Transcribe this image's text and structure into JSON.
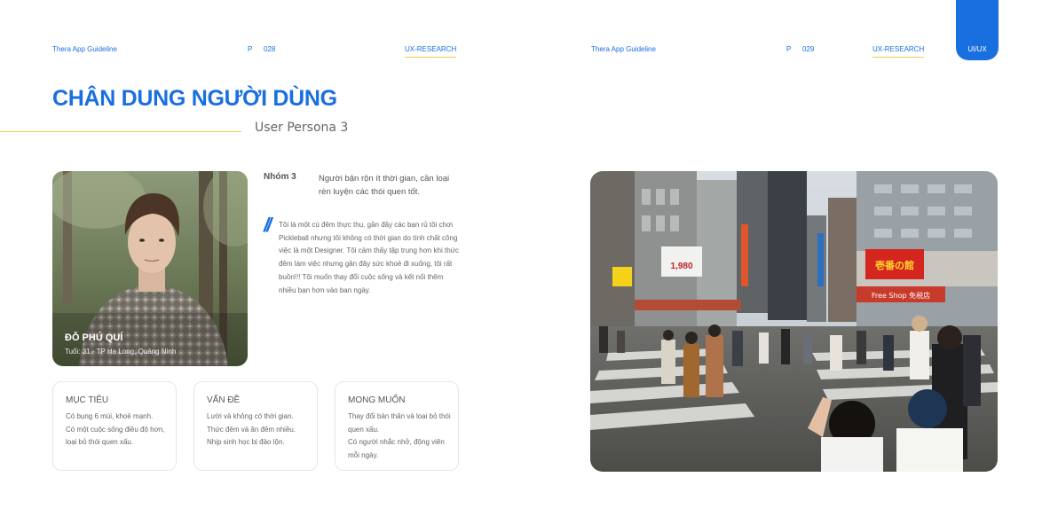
{
  "header_left": {
    "guide": "Thera App Guideline",
    "page_prefix": "P",
    "page_number": "028",
    "tab": "UX-RESEARCH"
  },
  "header_right": {
    "guide": "Thera App Guideline",
    "page_prefix": "P",
    "page_number": "029",
    "tab": "UX-RESEARCH"
  },
  "side_tab": "UI/UX",
  "title": "CHÂN DUNG NGƯỜI DÙNG",
  "subtitle": "User Persona 3",
  "persona": {
    "name": "ĐỖ PHÚ QUÍ",
    "info": "Tuổi: 31 - TP Hạ Long, Quảng Ninh",
    "group_label": "Nhóm 3",
    "group_desc": "Người bận rộn ít thời gian, cần loại rèn luyện các thói quen tốt.",
    "quote": "Tôi là một cú đêm thực thụ, gần đây các bạn rủ tôi chơi Pickleball nhưng tôi không có thời gian do tính chất công việc là một Designer. Tôi cảm thấy tập trung hơn khi thức đêm làm việc nhưng gần đây sức khoẻ đi xuống, tôi rất buồn!!! Tôi muốn thay đổi cuộc sống và kết nối thêm nhiều bạn hơn vào ban ngày."
  },
  "cards": [
    {
      "title": "MỤC TIÊU",
      "lines": [
        "Có bụng 6 múi, khoẻ mạnh.",
        "Có một cuộc sống điều độ hơn, loại bỏ thói quen xấu."
      ]
    },
    {
      "title": "VẤN ĐỀ",
      "lines": [
        "Lười và không có thời gian.",
        "Thức đêm và ăn đêm nhiều.",
        "Nhịp sinh học bị đảo lộn."
      ]
    },
    {
      "title": "MONG MUỐN",
      "lines": [
        "Thay đổi bản thân và loại bỏ thói quen xấu.",
        "Có người nhắc nhở, động viên mỗi ngày."
      ]
    }
  ],
  "photo_signs": {
    "price": "1,980",
    "store": "壱番の館",
    "shop": "Free Shop 免税店"
  },
  "colors": {
    "accent": "#1a6fe0",
    "underline": "#f2c94c"
  }
}
